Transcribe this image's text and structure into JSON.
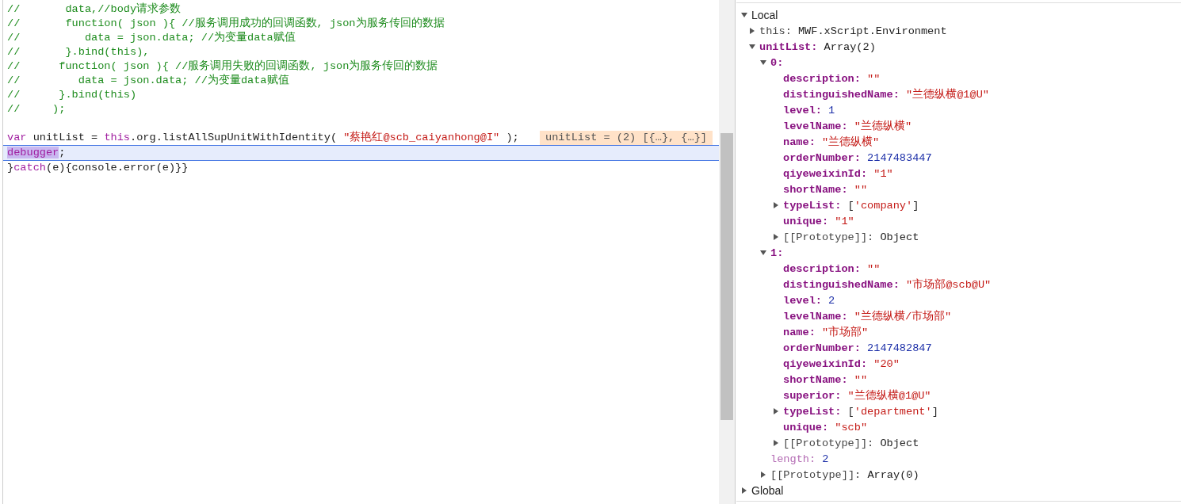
{
  "editor": {
    "lines": [
      {
        "current": false,
        "segments": [
          {
            "kind": "comment",
            "text": "//       data,//body请求参数"
          }
        ]
      },
      {
        "current": false,
        "segments": [
          {
            "kind": "comment",
            "text": "//       function( json ){ //服务调用成功的回调函数, json为服务传回的数据"
          }
        ]
      },
      {
        "current": false,
        "segments": [
          {
            "kind": "comment",
            "text": "//          data = json.data; //为变量data赋值"
          }
        ]
      },
      {
        "current": false,
        "segments": [
          {
            "kind": "comment",
            "text": "//       }.bind(this),"
          }
        ]
      },
      {
        "current": false,
        "segments": [
          {
            "kind": "comment",
            "text": "//      function( json ){ //服务调用失败的回调函数, json为服务传回的数据"
          }
        ]
      },
      {
        "current": false,
        "segments": [
          {
            "kind": "comment",
            "text": "//         data = json.data; //为变量data赋值"
          }
        ]
      },
      {
        "current": false,
        "segments": [
          {
            "kind": "comment",
            "text": "//      }.bind(this)"
          }
        ]
      },
      {
        "current": false,
        "segments": [
          {
            "kind": "comment",
            "text": "//     );"
          }
        ]
      },
      {
        "current": false
      },
      {
        "current": false,
        "segments": [
          {
            "kind": "keyword",
            "text": "var"
          },
          {
            "kind": "plain",
            "text": " unitList = "
          },
          {
            "kind": "keyword",
            "text": "this"
          },
          {
            "kind": "plain",
            "text": ".org.listAllSupUnitWithIdentity( "
          },
          {
            "kind": "string",
            "text": "\"蔡艳红@scb_caiyanhong@I\""
          },
          {
            "kind": "plain",
            "text": " );"
          }
        ],
        "inline_value": "unitList = (2) [{…}, {…}]"
      },
      {
        "current": true,
        "segments": [
          {
            "kind": "keyword-highlight",
            "text": "debugger"
          },
          {
            "kind": "plain",
            "text": ";"
          }
        ]
      },
      {
        "current": false,
        "segments": [
          {
            "kind": "plain",
            "text": "}"
          },
          {
            "kind": "keyword",
            "text": "catch"
          },
          {
            "kind": "plain",
            "text": "(e){console.error(e)}}"
          }
        ]
      }
    ]
  },
  "scope": {
    "items": [
      {
        "kind": "scope",
        "name": "Local",
        "expanded": true,
        "children": [
          {
            "kind": "plain",
            "name": "this:",
            "expanded": false,
            "value": [
              {
                "kind": "plain",
                "text": "MWF.xScript.Environment"
              }
            ]
          },
          {
            "kind": "own",
            "name": "unitList:",
            "expanded": true,
            "value": [
              {
                "kind": "plain",
                "text": "Array(2)"
              }
            ],
            "children": [
              {
                "kind": "own",
                "name": "0:",
                "expanded": true,
                "children": [
                  {
                    "kind": "own",
                    "name": "description:",
                    "value": [
                      {
                        "kind": "string",
                        "text": "\"\""
                      }
                    ]
                  },
                  {
                    "kind": "own",
                    "name": "distinguishedName:",
                    "value": [
                      {
                        "kind": "string",
                        "text": "\"兰德纵横@1@U\""
                      }
                    ]
                  },
                  {
                    "kind": "own",
                    "name": "level:",
                    "value": [
                      {
                        "kind": "number",
                        "text": "1"
                      }
                    ]
                  },
                  {
                    "kind": "own",
                    "name": "levelName:",
                    "value": [
                      {
                        "kind": "string",
                        "text": "\"兰德纵横\""
                      }
                    ]
                  },
                  {
                    "kind": "own",
                    "name": "name:",
                    "value": [
                      {
                        "kind": "string",
                        "text": "\"兰德纵横\""
                      }
                    ]
                  },
                  {
                    "kind": "own",
                    "name": "orderNumber:",
                    "value": [
                      {
                        "kind": "number",
                        "text": "2147483447"
                      }
                    ]
                  },
                  {
                    "kind": "own",
                    "name": "qiyeweixinId:",
                    "value": [
                      {
                        "kind": "string",
                        "text": "\"1\""
                      }
                    ]
                  },
                  {
                    "kind": "own",
                    "name": "shortName:",
                    "value": [
                      {
                        "kind": "string",
                        "text": "\"\""
                      }
                    ]
                  },
                  {
                    "kind": "own",
                    "name": "typeList:",
                    "expanded": false,
                    "value": [
                      {
                        "kind": "plain",
                        "text": "["
                      },
                      {
                        "kind": "string",
                        "text": "'company'"
                      },
                      {
                        "kind": "plain",
                        "text": "]"
                      }
                    ]
                  },
                  {
                    "kind": "own",
                    "name": "unique:",
                    "value": [
                      {
                        "kind": "string",
                        "text": "\"1\""
                      }
                    ]
                  },
                  {
                    "kind": "plain",
                    "name": "[[Prototype]]:",
                    "expanded": false,
                    "value": [
                      {
                        "kind": "plain",
                        "text": "Object"
                      }
                    ]
                  }
                ]
              },
              {
                "kind": "own",
                "name": "1:",
                "expanded": true,
                "children": [
                  {
                    "kind": "own",
                    "name": "description:",
                    "value": [
                      {
                        "kind": "string",
                        "text": "\"\""
                      }
                    ]
                  },
                  {
                    "kind": "own",
                    "name": "distinguishedName:",
                    "value": [
                      {
                        "kind": "string",
                        "text": "\"市场部@scb@U\""
                      }
                    ]
                  },
                  {
                    "kind": "own",
                    "name": "level:",
                    "value": [
                      {
                        "kind": "number",
                        "text": "2"
                      }
                    ]
                  },
                  {
                    "kind": "own",
                    "name": "levelName:",
                    "value": [
                      {
                        "kind": "string",
                        "text": "\"兰德纵横/市场部\""
                      }
                    ]
                  },
                  {
                    "kind": "own",
                    "name": "name:",
                    "value": [
                      {
                        "kind": "string",
                        "text": "\"市场部\""
                      }
                    ]
                  },
                  {
                    "kind": "own",
                    "name": "orderNumber:",
                    "value": [
                      {
                        "kind": "number",
                        "text": "2147482847"
                      }
                    ]
                  },
                  {
                    "kind": "own",
                    "name": "qiyeweixinId:",
                    "value": [
                      {
                        "kind": "string",
                        "text": "\"20\""
                      }
                    ]
                  },
                  {
                    "kind": "own",
                    "name": "shortName:",
                    "value": [
                      {
                        "kind": "string",
                        "text": "\"\""
                      }
                    ]
                  },
                  {
                    "kind": "own",
                    "name": "superior:",
                    "value": [
                      {
                        "kind": "string",
                        "text": "\"兰德纵横@1@U\""
                      }
                    ]
                  },
                  {
                    "kind": "own",
                    "name": "typeList:",
                    "expanded": false,
                    "value": [
                      {
                        "kind": "plain",
                        "text": "["
                      },
                      {
                        "kind": "string",
                        "text": "'department'"
                      },
                      {
                        "kind": "plain",
                        "text": "]"
                      }
                    ]
                  },
                  {
                    "kind": "own",
                    "name": "unique:",
                    "value": [
                      {
                        "kind": "string",
                        "text": "\"scb\""
                      }
                    ]
                  },
                  {
                    "kind": "plain",
                    "name": "[[Prototype]]:",
                    "expanded": false,
                    "value": [
                      {
                        "kind": "plain",
                        "text": "Object"
                      }
                    ]
                  }
                ]
              },
              {
                "kind": "dim",
                "name": "length:",
                "value": [
                  {
                    "kind": "number",
                    "text": "2"
                  }
                ]
              },
              {
                "kind": "plain",
                "name": "[[Prototype]]:",
                "expanded": false,
                "value": [
                  {
                    "kind": "plain",
                    "text": "Array(0)"
                  }
                ]
              }
            ]
          }
        ]
      },
      {
        "kind": "scope",
        "name": "Global",
        "expanded": false
      }
    ]
  }
}
